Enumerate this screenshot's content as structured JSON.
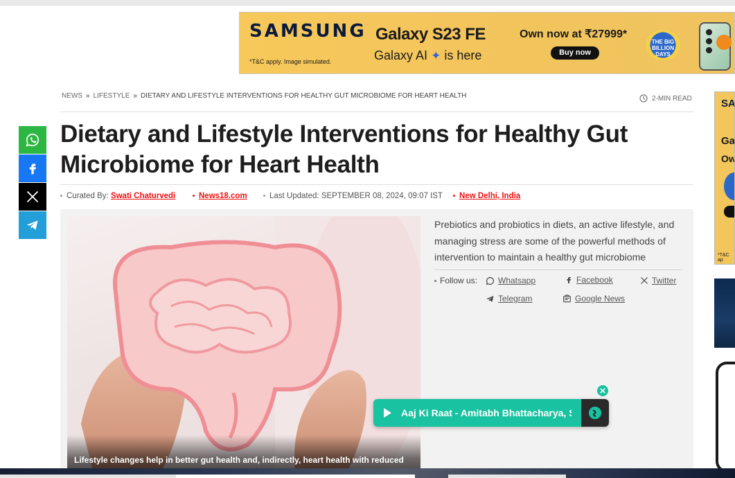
{
  "ad_banner": {
    "brand": "SAMSUNG",
    "model": "Galaxy S23 FE",
    "ai_prefix": "Galaxy AI",
    "ai_suffix": "is here",
    "price": "Own now at ₹27999*",
    "cta": "Buy now",
    "sale_badge": "THE BIG BILLION DAYS",
    "terms": "*T&C apply. Image simulated."
  },
  "breadcrumb": {
    "items": [
      "NEWS",
      "LIFESTYLE",
      "DIETARY AND LIFESTYLE INTERVENTIONS FOR HEALTHY GUT MICROBIOME FOR HEART HEALTH"
    ],
    "separator": "»"
  },
  "read_time": "2-MIN READ",
  "article": {
    "title": "Dietary and Lifestyle Interventions for Healthy Gut Microbiome for Heart Health",
    "curated_label": "Curated By:",
    "author": "Swati Chaturvedi",
    "source": "News18.com",
    "updated_label": "Last Updated:",
    "updated_value": "SEPTEMBER 08, 2024, 09:07 IST",
    "location": "New Delhi, India",
    "summary": "Prebiotics and probiotics in diets, an active lifestyle, and managing stress are some of the powerful methods of intervention to maintain a healthy gut microbiome",
    "image_caption": "Lifestyle changes help in better gut health and, indirectly, heart health with reduced"
  },
  "follow": {
    "label": "Follow us:",
    "channels": [
      "Whatsapp",
      "Facebook",
      "Twitter",
      "Telegram",
      "Google News"
    ]
  },
  "share_icons": [
    "whatsapp-icon",
    "facebook-icon",
    "x-icon",
    "telegram-icon"
  ],
  "rail_ad": {
    "brand": "SA",
    "line1": "Ga",
    "line2": "Ow",
    "terms": "*T&C ap"
  },
  "player": {
    "track": "Aaj Ki Raat - Amitabh Bhattacharya, S"
  },
  "colors": {
    "accent_red": "#e11111",
    "whatsapp": "#2bb741",
    "facebook": "#1877f2",
    "x": "#000000",
    "telegram": "#229ed9",
    "player": "#19c2a0",
    "ad_yellow": "#f3c55c"
  }
}
